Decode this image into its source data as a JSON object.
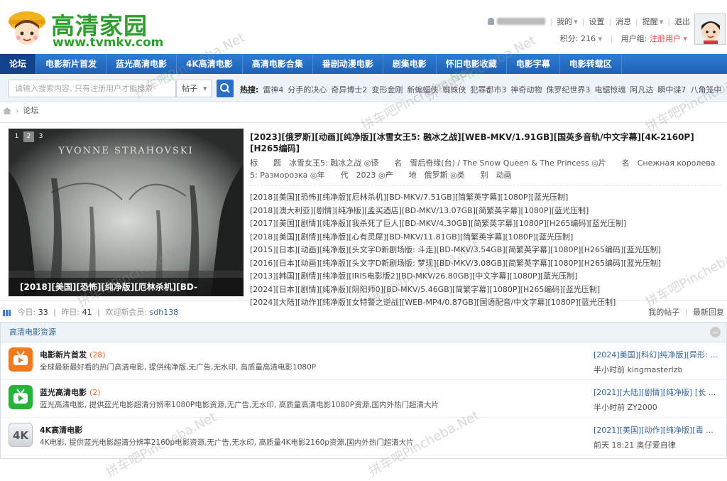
{
  "site": {
    "title": "高清家园",
    "url": "www.tvmkv.com"
  },
  "user": {
    "links": [
      "我的",
      "设置",
      "消息",
      "提醒",
      "退出"
    ],
    "points_label": "积分: 216",
    "group_label": "用户组:",
    "group_value": "注册用户"
  },
  "nav": {
    "items": [
      "论坛",
      "电影新片首发",
      "蓝光高清电影",
      "4K高清电影",
      "高清电影合集",
      "番剧动漫电影",
      "剧集电影",
      "怀旧电影收藏",
      "电影字幕",
      "电影转载区"
    ]
  },
  "search": {
    "placeholder": "请输入搜索内容, 只有注册用户才能搜索",
    "scope": "帖子",
    "hot_label": "热搜:",
    "hot_terms": [
      "雷神4",
      "分手的决心",
      "奇异博士2",
      "变形金刚",
      "新蝙蝠侠",
      "蜘蛛侠",
      "犯罪都市3",
      "神奇动物",
      "侏罗纪世界3",
      "电锯惊魂",
      "阿凡达",
      "瞬中谍7",
      "八角笼中"
    ]
  },
  "breadcrumb": {
    "current": "论坛"
  },
  "featured": {
    "pager": [
      "1",
      "2",
      "3"
    ],
    "slide_author": "YVONNE STRAHOVSKI",
    "slide_caption": "[2018][美国][恐怖][纯净版][厄林杀机][BD-",
    "title": "[2023][俄罗斯][动画][纯净版][冰雪女王5: 融冰之战][WEB-MKV/1.91GB][国英多音轨/中文字幕][4K-2160P][H265编码]",
    "desc": "标　　题　冰雪女王5: 融冰之战 ◎译　　名　雪后奇缘(台) / The Snow Queen & The Princess ◎片　　名　Снежная королева 5: Разморозка ◎年　　代　2023 ◎产　　地　俄罗斯 ◎类　　别　动画",
    "list": [
      "[2018][美国][恐怖][纯净版][厄林杀机][BD-MKV/7.51GB][简繁英字幕][1080P][蓝光压制]",
      "[2018][澳大利亚][剧情][纯净版][孟买酒店][BD-MKV/13.07GB][简繁英字幕][1080P][蓝光压制]",
      "[2017][美国][剧情][纯净版][我杀死了巨人][BD-MKV/4.30GB][简繁英字幕][1080P][H265编码][蓝光压制]",
      "[2018][美国][剧情][纯净版][心有灵犀][BD-MKV/11.81GB][简繁英字幕][1080P][蓝光压制]",
      "[2015][日本][动画][纯净版][头文字D新剧场版: 斗走][BD-MKV/3.54GB][简繁英字幕][1080P][H265编码][蓝光压制]",
      "[2016][日本][动画][纯净版][头文字D新剧场版: 梦现][BD-MKV/3.08GB][简繁英字幕][1080P][H265编码][蓝光压制]",
      "[2013][韩国][剧情][纯净版][IRIS电影版2][BD-MKV/26.80GB][中文字幕][1080P][蓝光压制]",
      "[2024][日本][剧情][纯净版][阴阳师0][BD-MKV/5.46GB][简繁字幕][1080P][H265编码][蓝光压制]",
      "[2024][大陆][动作][纯净版][女特警之逆战][WEB-MP4/0.87GB][国语配音/中文字幕][1080P][蓝光压制]"
    ]
  },
  "stats": {
    "today_label": "今日:",
    "today_value": "33",
    "yesterday_label": "昨日:",
    "yesterday_value": "41",
    "welcome_label": "欢迎新会员:",
    "new_member": "sdh138",
    "my_posts": "我的帖子",
    "latest": "最新回复"
  },
  "section": {
    "title": "高清电影资源",
    "forums": [
      {
        "name": "电影新片首发",
        "count": "(28)",
        "desc": "全球最新最好看的热门高清电影, 提供纯净版,无广告,无水印, 高质量高清电影1080P",
        "last_title": "[2024]美国][科幻]纯净版][异形: ...",
        "last_when": "半小时前 kingmasterlzb",
        "icon_color": "#f07a1c"
      },
      {
        "name": "蓝光高清电影",
        "count": "(2)",
        "desc": "蓝光高清电影, 提供蓝光电影超清分辨率1080P电影资源,无广告,无水印, 高质量高清电影1080P资源,国内外热门超清大片",
        "last_title": "[2021][大陆][剧情][纯净版] [长 ...",
        "last_when": "半小时前 ZY2000",
        "icon_color": "#25b33a"
      },
      {
        "name": "4K高清电影",
        "count": "",
        "desc": "4K电影, 提供蓝光电影超清分辨率2160p电影资源,无广告,无水印, 高质量4K电影2160p资源,国内外热门超清大片",
        "last_title": "[2021][美国][动作][纯净版][毒 ...",
        "last_when": "前天 18:21 奥仔爱自律",
        "icon_color": "#d8dde3",
        "icon_text": "4K"
      }
    ]
  },
  "watermark": "拼车吧Pincheba.Net"
}
